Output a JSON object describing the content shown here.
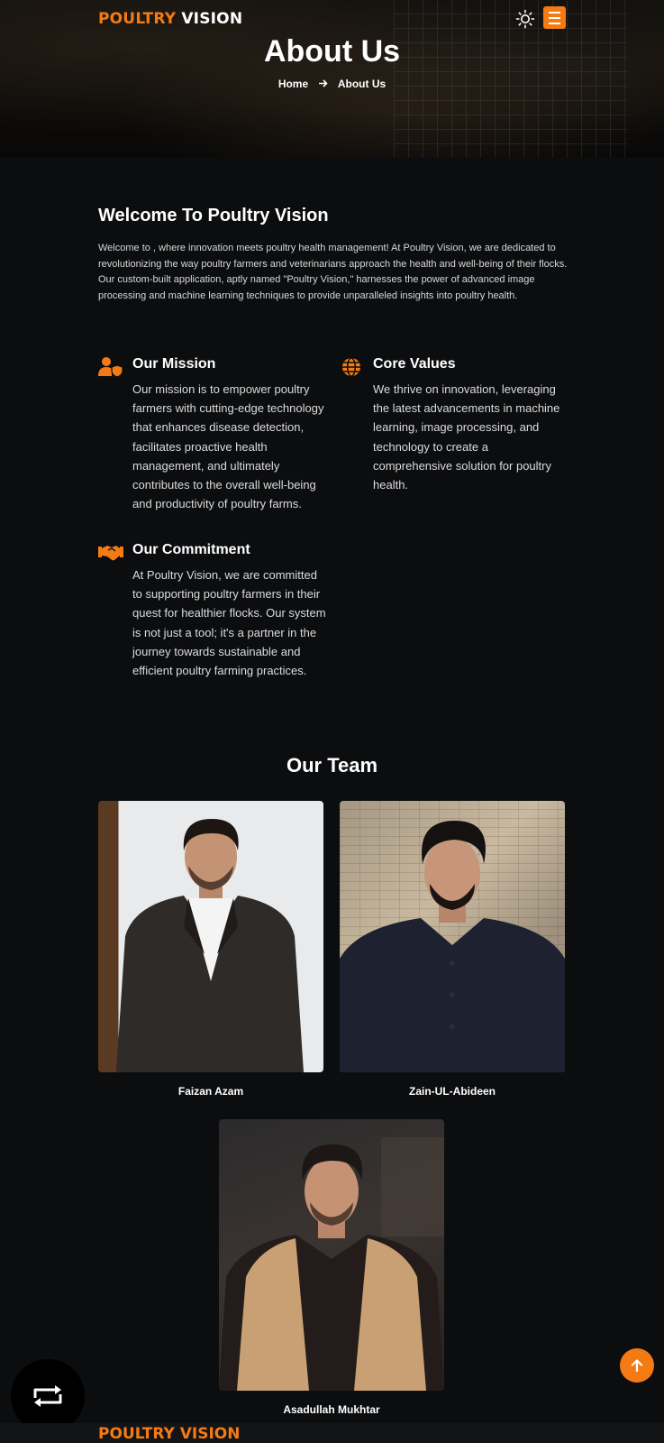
{
  "header": {
    "brand_primary": "POULTRY",
    "brand_secondary": "VISION",
    "theme_toggle_icon": "sun-icon",
    "menu_icon": "hamburger-menu-icon",
    "accent_color": "#f47b14"
  },
  "hero": {
    "title": "About Us",
    "breadcrumb": {
      "home": "Home",
      "separator_icon": "arrow-right-icon",
      "current": "About Us"
    }
  },
  "welcome": {
    "heading": "Welcome To Poultry Vision",
    "body": "Welcome to , where innovation meets poultry health management! At Poultry Vision, we are dedicated to revolutionizing the way poultry farmers and veterinarians approach the health and well-being of their flocks. Our custom-built application, aptly named \"Poultry Vision,\" harnesses the power of advanced image processing and machine learning techniques to provide unparalleled insights into poultry health."
  },
  "features": {
    "mission": {
      "icon": "user-shield-icon",
      "title": "Our Mission",
      "text": "Our mission is to empower poultry farmers with cutting-edge technology that enhances disease detection, facilitates proactive health management, and ultimately contributes to the overall well-being and productivity of poultry farms."
    },
    "values": {
      "icon": "globe-icon",
      "title": "Core Values",
      "text": "We thrive on innovation, leveraging the latest advancements in machine learning, image processing, and technology to create a comprehensive solution for poultry health."
    },
    "commitment": {
      "icon": "handshake-icon",
      "title": "Our Commitment",
      "text": "At Poultry Vision, we are committed to supporting poultry farmers in their quest for healthier flocks. Our system is not just a tool; it's a partner in the journey towards sustainable and efficient poultry farming practices."
    }
  },
  "team": {
    "heading": "Our Team",
    "members": [
      {
        "name": "Faizan Azam"
      },
      {
        "name": "Zain-UL-Abideen"
      },
      {
        "name": "Asadullah Mukhtar"
      }
    ]
  },
  "floating": {
    "left_button_icon": "repeat-icon",
    "back_to_top_icon": "arrow-up-icon"
  },
  "footer": {
    "brand": "POULTRY VISION"
  }
}
